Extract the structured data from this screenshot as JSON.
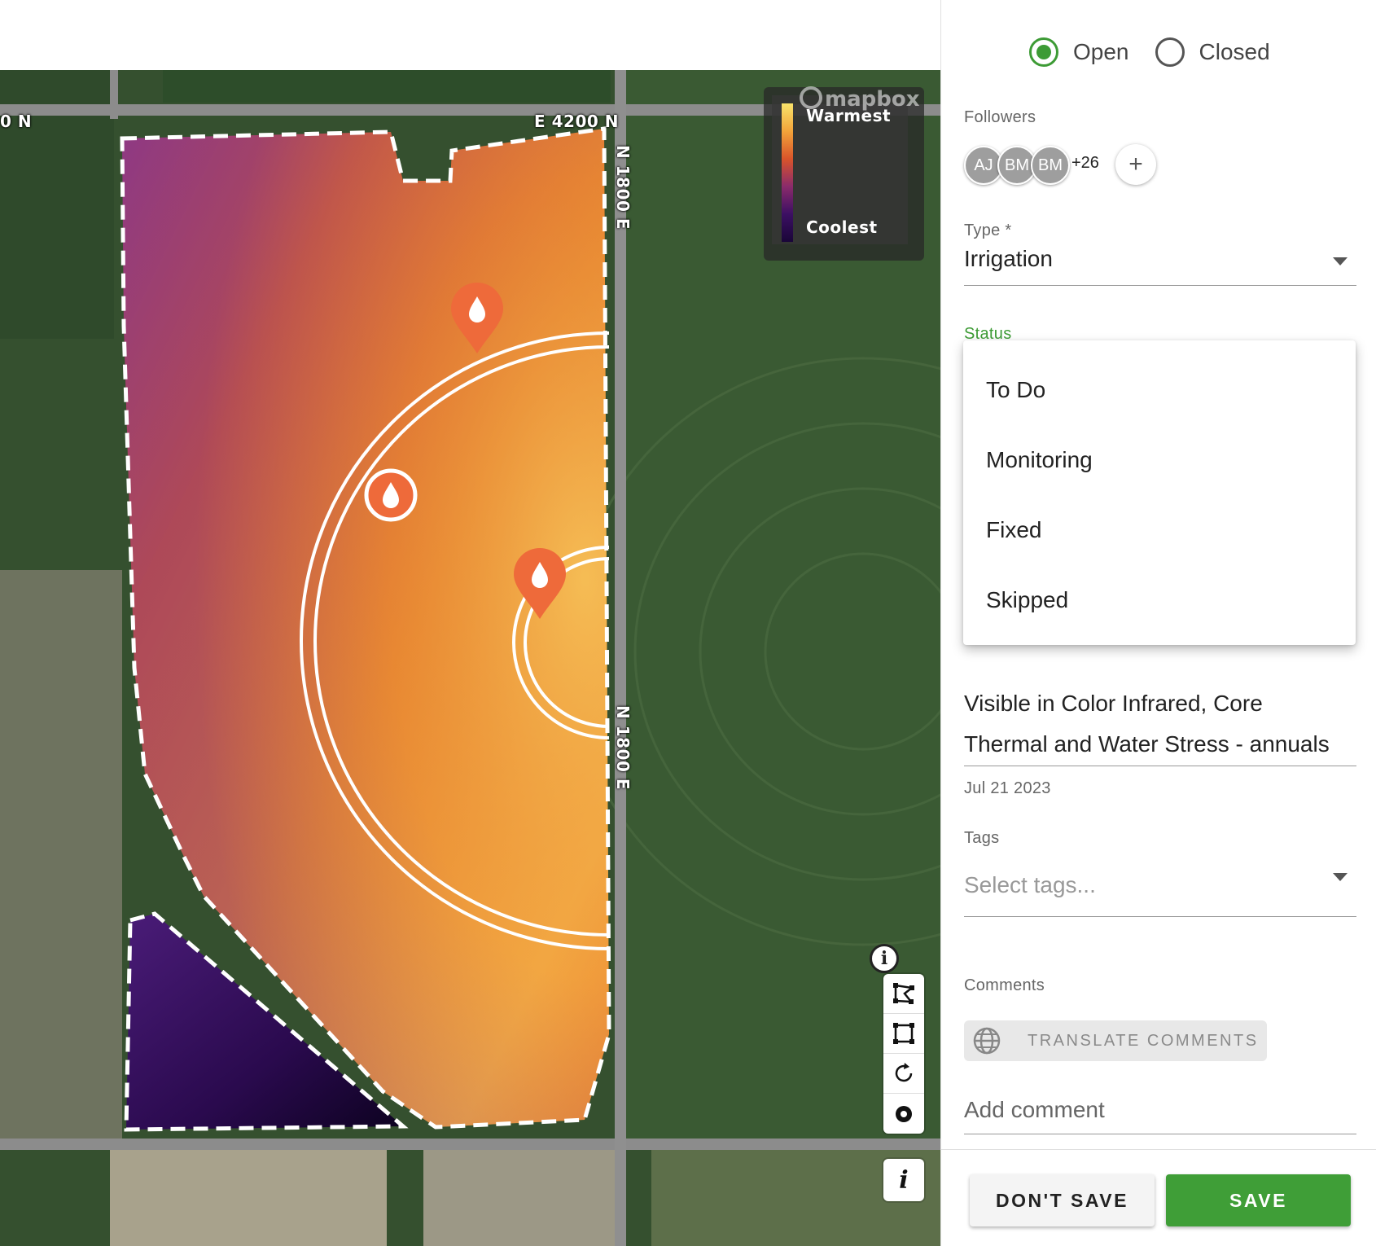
{
  "map": {
    "roads": {
      "north_west": "0 N",
      "north_east": "E 4200 N",
      "east_upper": "N 1800 E",
      "east_lower": "N 1800 E"
    },
    "legend": {
      "warmest": "Warmest",
      "coolest": "Coolest",
      "attribution": "mapbox"
    },
    "controls": {
      "info_top": "i",
      "info_bottom": "i",
      "tools": [
        "draw-polygon-icon",
        "draw-rectangle-icon",
        "rotate-icon",
        "draw-point-icon"
      ]
    },
    "markers": [
      "water-drop-icon",
      "water-drop-icon",
      "water-drop-icon"
    ]
  },
  "panel": {
    "state": {
      "open_label": "Open",
      "closed_label": "Closed",
      "selected": "Open"
    },
    "followers": {
      "label": "Followers",
      "avatars": [
        "AJ",
        "BM",
        "BM"
      ],
      "more": "+26",
      "add": "+"
    },
    "type": {
      "label": "Type *",
      "value": "Irrigation"
    },
    "status": {
      "label": "Status",
      "options": [
        "To Do",
        "Monitoring",
        "Fixed",
        "Skipped"
      ]
    },
    "description": {
      "line1": "Visible in Color Infrared, Core",
      "line2": "Thermal and Water Stress - annuals",
      "date": "Jul 21 2023"
    },
    "tags": {
      "label": "Tags",
      "placeholder": "Select tags..."
    },
    "comments": {
      "label": "Comments",
      "translate": "TRANSLATE COMMENTS",
      "placeholder": "Add comment"
    },
    "actions": {
      "dont_save": "DON'T SAVE",
      "save": "SAVE"
    }
  },
  "colors": {
    "accent_green": "#3f9e37",
    "marker_orange": "#ee6a3a",
    "heat_warm": "#f3a43a",
    "heat_cool": "#3c0f63"
  }
}
